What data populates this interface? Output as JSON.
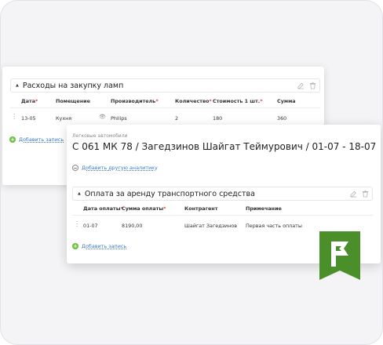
{
  "colors": {
    "accent_green": "#6abf3c",
    "link_blue": "#3d7bc4",
    "required_red": "#e0452f",
    "logo_green": "#4a8f2a"
  },
  "expenses_section": {
    "title": "Расходы на закупку ламп",
    "columns": [
      "Дата",
      "Помещение",
      "Производитель",
      "Количество",
      "Стоимость 1 шт.",
      "Сумма"
    ],
    "row": {
      "date": "13-05",
      "room": "Кухня",
      "manufacturer": "Philips",
      "quantity": "2",
      "unit_cost": "180",
      "sum": "360"
    },
    "add_record": "Добавить запись"
  },
  "trip_card": {
    "subtitle": "Легковые автомобили",
    "title": "С 061 МК 78 / Загедзинов Шайгат Теймурович / 01-07 - 18-07",
    "add_analytic": "Добавить другую аналитику",
    "payment_section": {
      "title": "Оплата за аренду транспортного средства",
      "columns": [
        "Дата оплаты",
        "Сумма оплаты",
        "Контрагент",
        "Примечание"
      ],
      "row": {
        "date": "01-07",
        "amount": "8190,00",
        "counterparty": "Шайгат Загедзинов",
        "note": "Первая часть оплаты"
      },
      "add_record": "Добавить запись"
    }
  },
  "logo": {
    "icon": "flag-logo-icon"
  }
}
